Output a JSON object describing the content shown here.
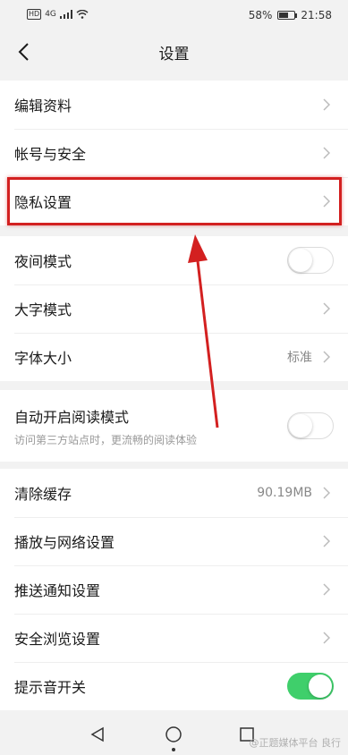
{
  "status_bar": {
    "signal_label": "4G",
    "battery_percent": "58%",
    "battery_level": 0.58,
    "time": "21:58"
  },
  "header": {
    "title": "设置",
    "back_icon": "chevron-left-icon"
  },
  "section1": {
    "items": [
      {
        "label": "编辑资料"
      },
      {
        "label": "帐号与安全"
      },
      {
        "label": "隐私设置"
      }
    ]
  },
  "section2": {
    "night_mode": {
      "label": "夜间模式",
      "enabled": false
    },
    "large_text": {
      "label": "大字模式"
    },
    "font_size": {
      "label": "字体大小",
      "value": "标准"
    }
  },
  "section3": {
    "auto_reading": {
      "label": "自动开启阅读模式",
      "sublabel": "访问第三方站点时，更流畅的阅读体验",
      "enabled": false
    }
  },
  "section4": {
    "clear_cache": {
      "label": "清除缓存",
      "value": "90.19MB"
    },
    "playback_network": {
      "label": "播放与网络设置"
    },
    "push_notifications": {
      "label": "推送通知设置"
    },
    "safe_browsing": {
      "label": "安全浏览设置"
    },
    "sound_toggle": {
      "label": "提示音开关",
      "enabled": true
    }
  },
  "annotation": {
    "highlight_color": "#d32020"
  },
  "bottom_nav": {
    "back": "triangle-back-icon",
    "home": "circle-home-icon",
    "recents": "square-recents-icon"
  },
  "watermark": "@正题媒体平台 良行"
}
